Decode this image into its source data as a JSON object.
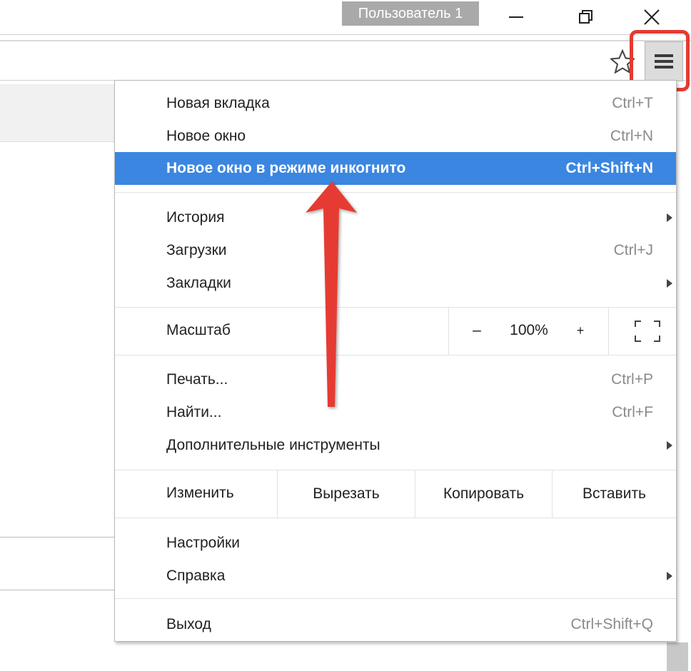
{
  "window": {
    "profile_label": "Пользователь 1",
    "minimize_icon": "minimize-icon",
    "restore_icon": "restore-icon",
    "close_icon": "close-icon"
  },
  "toolbar": {
    "bookmark_icon": "star-icon",
    "menu_icon": "hamburger-menu-icon",
    "highlight_color": "#e63a32"
  },
  "menu": {
    "new_tab": {
      "label": "Новая вкладка",
      "shortcut": "Ctrl+T"
    },
    "new_window": {
      "label": "Новое окно",
      "shortcut": "Ctrl+N"
    },
    "incognito": {
      "label": "Новое окно в режиме инкогнито",
      "shortcut": "Ctrl+Shift+N"
    },
    "history": {
      "label": "История"
    },
    "downloads": {
      "label": "Загрузки",
      "shortcut": "Ctrl+J"
    },
    "bookmarks": {
      "label": "Закладки"
    },
    "zoom": {
      "label": "Масштаб",
      "minus": "–",
      "value": "100%",
      "plus": "+"
    },
    "print": {
      "label": "Печать...",
      "shortcut": "Ctrl+P"
    },
    "find": {
      "label": "Найти...",
      "shortcut": "Ctrl+F"
    },
    "more_tools": {
      "label": "Дополнительные инструменты"
    },
    "edit": {
      "label": "Изменить",
      "cut": "Вырезать",
      "copy": "Копировать",
      "paste": "Вставить"
    },
    "settings": {
      "label": "Настройки"
    },
    "help": {
      "label": "Справка"
    },
    "exit": {
      "label": "Выход",
      "shortcut": "Ctrl+Shift+Q"
    }
  },
  "colors": {
    "highlight_bg": "#3b86e0",
    "annotation": "#e63a32"
  }
}
